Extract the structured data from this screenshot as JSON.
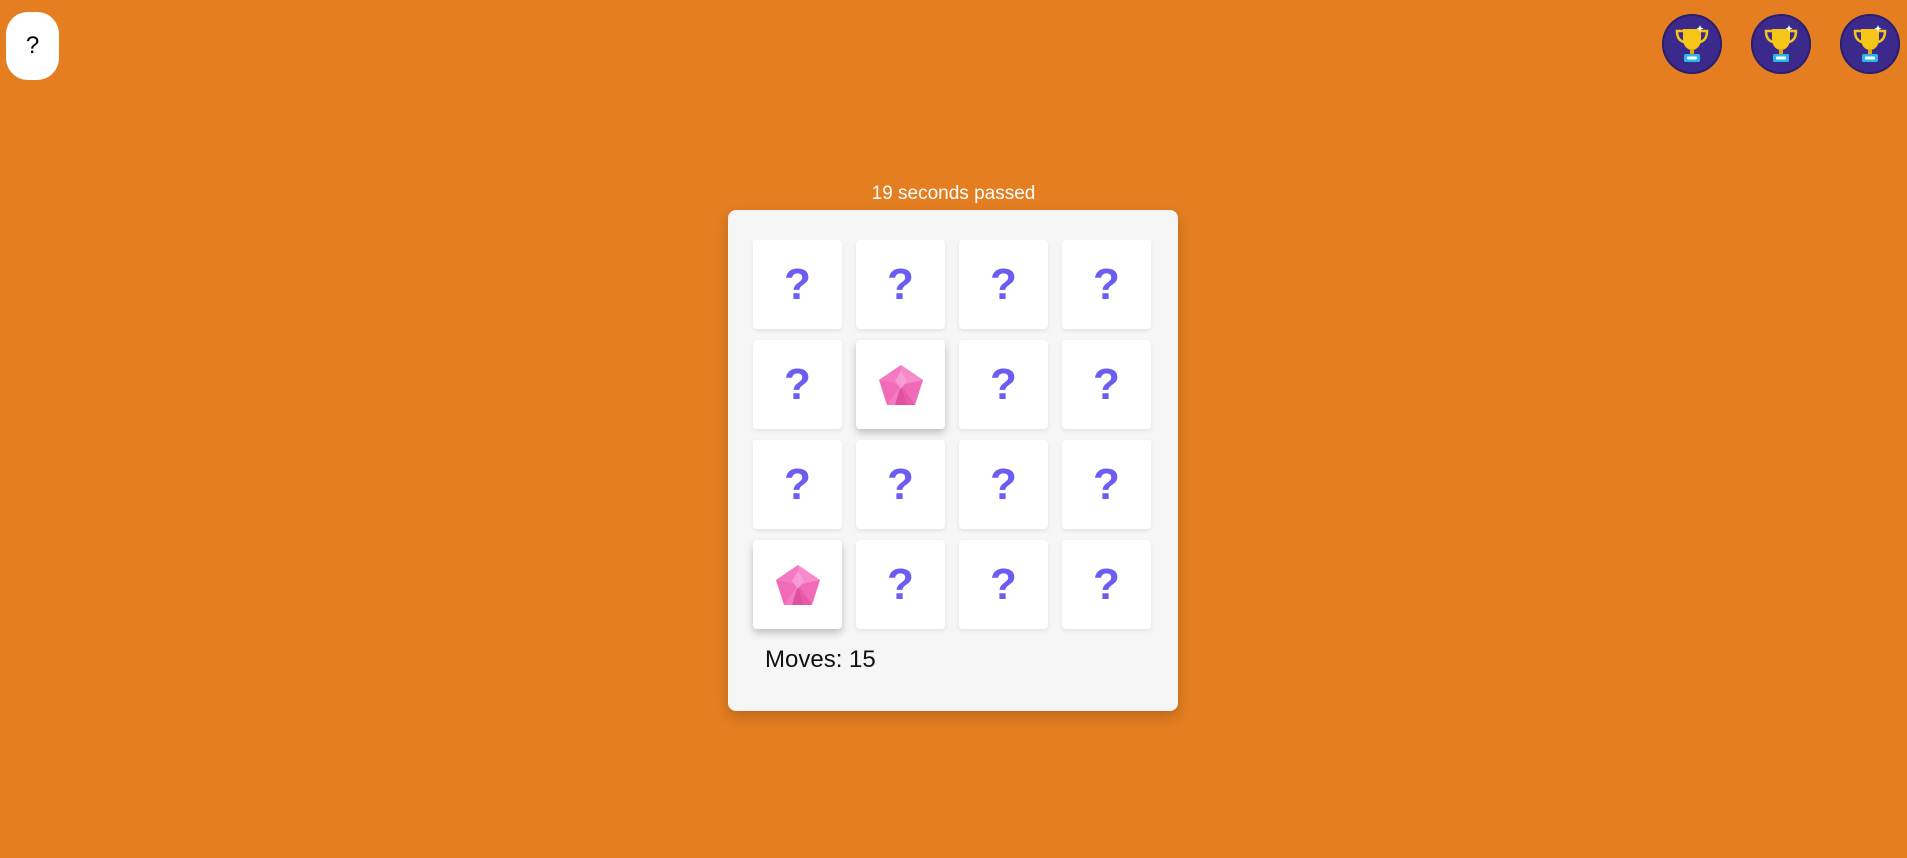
{
  "help_button": {
    "label": "?"
  },
  "trophies": [
    {
      "icon": "trophy-icon"
    },
    {
      "icon": "trophy-icon"
    },
    {
      "icon": "trophy-icon"
    }
  ],
  "timer_text": "19 seconds passed",
  "cards": [
    {
      "state": "hidden",
      "label": "?"
    },
    {
      "state": "hidden",
      "label": "?"
    },
    {
      "state": "hidden",
      "label": "?"
    },
    {
      "state": "hidden",
      "label": "?"
    },
    {
      "state": "hidden",
      "label": "?"
    },
    {
      "state": "revealed",
      "icon": "pink-gem-icon"
    },
    {
      "state": "hidden",
      "label": "?"
    },
    {
      "state": "hidden",
      "label": "?"
    },
    {
      "state": "hidden",
      "label": "?"
    },
    {
      "state": "hidden",
      "label": "?"
    },
    {
      "state": "hidden",
      "label": "?"
    },
    {
      "state": "hidden",
      "label": "?"
    },
    {
      "state": "revealed",
      "icon": "pink-gem-icon"
    },
    {
      "state": "hidden",
      "label": "?"
    },
    {
      "state": "hidden",
      "label": "?"
    },
    {
      "state": "hidden",
      "label": "?"
    }
  ],
  "moves_text": "Moves: 15",
  "colors": {
    "background": "#e47e21",
    "board": "#f6f6f6",
    "question_mark": "#6a5df0",
    "gem": "#f06ab8",
    "trophy_badge": "#3b2a8c",
    "trophy_gold": "#f5c518"
  }
}
